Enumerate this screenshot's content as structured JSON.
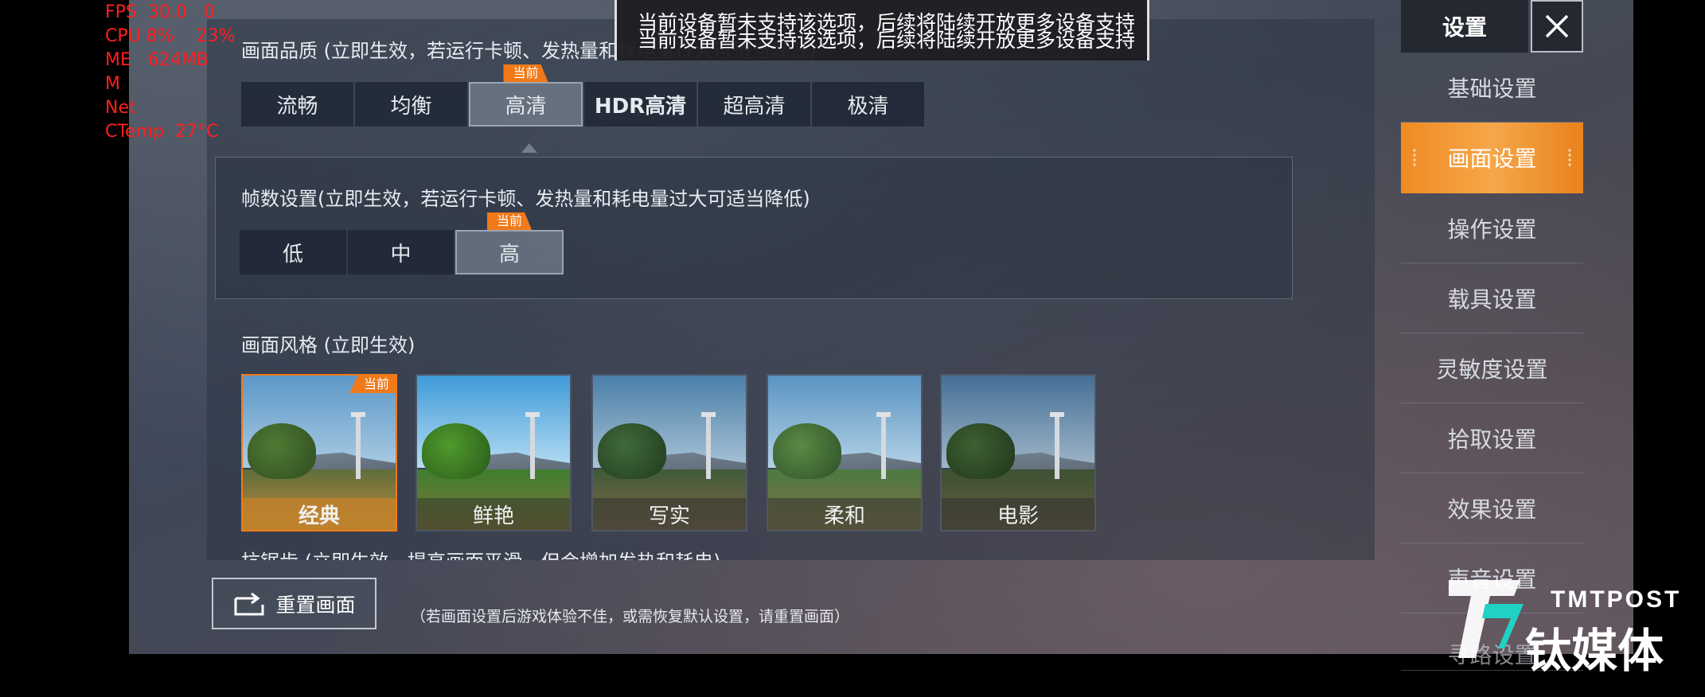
{
  "debug": {
    "lines": [
      "FPS  30.0   0",
      "CPU 8%    23%",
      "ME   624MB",
      "M",
      "Net",
      "CTemp  27°C"
    ]
  },
  "toast": {
    "line1": "当前设备暂未支持该选项，后续将陆续开放更多设备支持",
    "line2": "当前设备暂未支持该选项，后续将陆续开放更多设备支持"
  },
  "quality": {
    "title": "画面品质 (立即生效，若运行卡顿、发热量和耗电量过大可适当降低)",
    "options": [
      "流畅",
      "均衡",
      "高清",
      "HDR高清",
      "超高清",
      "极清"
    ],
    "selected": "高清",
    "badge": "当前"
  },
  "fps": {
    "title": "帧数设置(立即生效，若运行卡顿、发热量和耗电量过大可适当降低)",
    "options": [
      "低",
      "中",
      "高"
    ],
    "selected": "高",
    "badge": "当前"
  },
  "style": {
    "title": "画面风格 (立即生效)",
    "options": [
      "经典",
      "鲜艳",
      "写实",
      "柔和",
      "电影"
    ],
    "selected": "经典",
    "badge": "当前"
  },
  "antialias": {
    "title": "抗锯齿 (立即生效，提高画面平滑，但会增加发热和耗电)"
  },
  "reset": {
    "label": "重置画面",
    "note": "（若画面设置后游戏体验不佳，或需恢复默认设置，请重置画面）"
  },
  "sidebar": {
    "title": "设置",
    "items": [
      "基础设置",
      "画面设置",
      "操作设置",
      "载具设置",
      "灵敏度设置",
      "拾取设置",
      "效果设置",
      "声音设置",
      "寻路设置"
    ],
    "active": "画面设置"
  },
  "watermark": {
    "brand": "TMTPOST",
    "name": "钛媒体"
  },
  "colors": {
    "accent": "#f07a19",
    "debug_text": "#ff1f1f"
  }
}
